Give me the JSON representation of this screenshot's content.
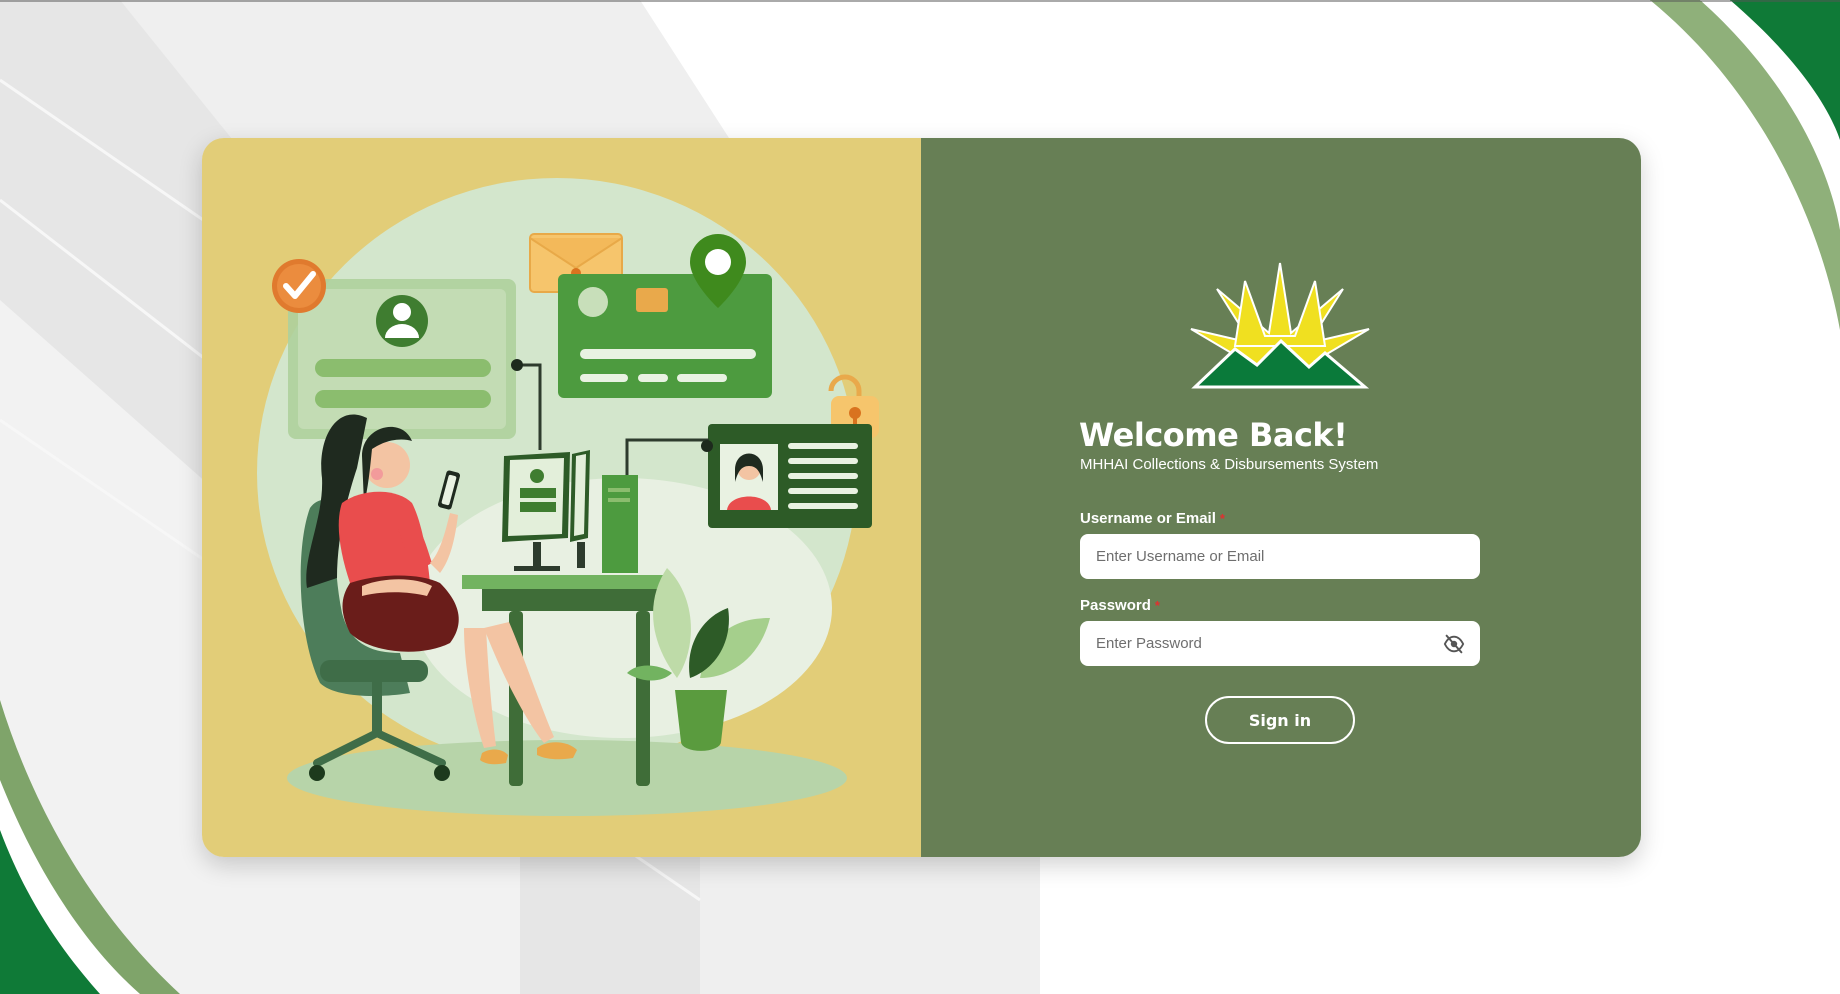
{
  "login": {
    "title": "Welcome Back!",
    "subtitle": "MHHAI Collections & Disbursements System",
    "username": {
      "label": "Username or Email",
      "required_marker": "*",
      "placeholder": "Enter Username or Email",
      "value": ""
    },
    "password": {
      "label": "Password",
      "required_marker": "*",
      "placeholder": "Enter Password",
      "value": "",
      "toggle_icon": "eye-slash-icon"
    },
    "submit_label": "Sign in"
  },
  "colors": {
    "panel_left": "#e2cd78",
    "panel_right": "#677f55",
    "accent_green": "#0a7a3a",
    "logo_yellow": "#f0e020"
  },
  "icons": {
    "logo": "sunburst-mountain-logo",
    "illustration": "woman-at-computer-illustration"
  }
}
